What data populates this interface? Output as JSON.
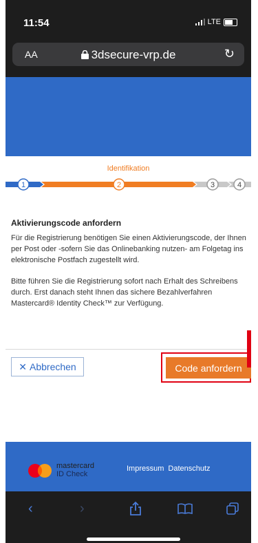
{
  "status_bar": {
    "time": "11:54",
    "signal": "LTE"
  },
  "browser": {
    "aa_label": "AA",
    "url": "3dsecure-vrp.de"
  },
  "progress": {
    "step_title": "Identifikation",
    "steps": [
      "1",
      "2",
      "3",
      "4"
    ],
    "current_step": 2,
    "colors": {
      "done": "#2f6ac6",
      "active": "#f07d23",
      "todo": "#c8c8c8"
    }
  },
  "content": {
    "heading": "Aktivierungscode anfordern",
    "paragraph1": "Für die Registrierung benötigen Sie einen Aktivierungscode, der Ihnen per Post oder -sofern Sie das Onlinebanking nutzen- am Folgetag ins elektronische Postfach zugestellt wird.",
    "paragraph2": "Bitte führen Sie die Registrierung sofort nach Erhalt des Schreibens durch. Erst danach steht Ihnen das sichere Bezahlverfahren Mastercard® Identity Check™ zur Verfügung."
  },
  "actions": {
    "cancel_label": "Abbrechen",
    "request_code_label": "Code anfordern"
  },
  "footer": {
    "brand_line1": "mastercard",
    "brand_line2": "ID Check",
    "links": [
      "Impressum",
      "Datenschutz"
    ]
  },
  "colors": {
    "brand_blue": "#2f6ac6",
    "accent_orange": "#e87a29",
    "highlight_red": "#e00012"
  }
}
